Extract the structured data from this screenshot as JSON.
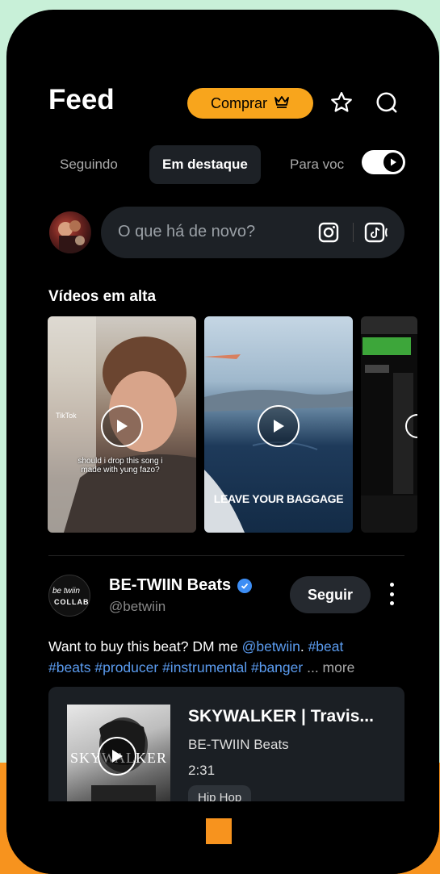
{
  "header": {
    "title": "Feed",
    "buy_label": "Comprar",
    "accent": "#f8a51c"
  },
  "tabs": [
    {
      "label": "Seguindo",
      "active": false
    },
    {
      "label": "Em destaque",
      "active": true
    },
    {
      "label": "Para voc",
      "active": false
    }
  ],
  "composer": {
    "placeholder": "O que há de novo?"
  },
  "trending": {
    "title": "Vídeos em alta",
    "videos": [
      {
        "caption": "should i drop this song i made with yung fazo?",
        "overlay_small": "TikTok"
      },
      {
        "caption": "LEAVE YOUR BAGGAGE"
      },
      {
        "caption": ""
      }
    ]
  },
  "post": {
    "author": "BE-TWIIN Beats",
    "handle": "@betwiin",
    "follow_label": "Seguir",
    "avatar_text_top": "be twiin",
    "avatar_text_bottom": "COLLAB",
    "text_intro": "Want to buy this beat? DM me ",
    "mention": "@betwiin",
    "tag1": "#beat",
    "tags_line2": "#beats #producer #instrumental #banger",
    "more_label": "... more",
    "track": {
      "title": "SKYWALKER | Travis...",
      "artist": "BE-TWIIN Beats",
      "duration": "2:31",
      "genre": "Hip Hop",
      "cover_text": "SKYWALKER"
    }
  },
  "colors": {
    "link_blue": "#5b9cf0",
    "verified_blue": "#3d8ef5",
    "home_indicator": "#f7931e"
  }
}
